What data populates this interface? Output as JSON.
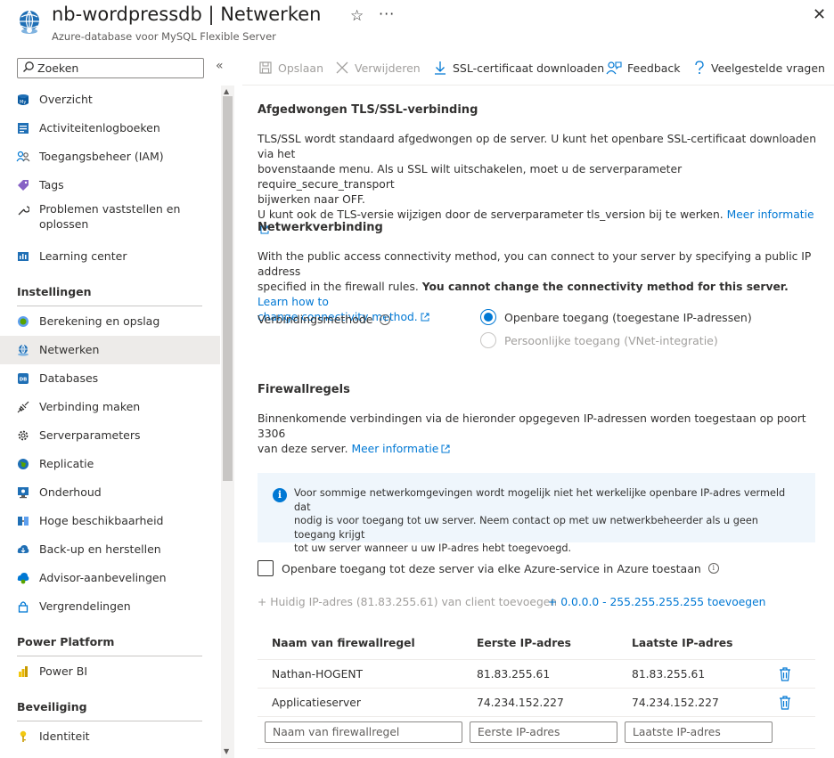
{
  "header": {
    "title": "nb-wordpressdb | Netwerken",
    "subtitle": "Azure-database voor MySQL Flexible Server",
    "favorite_glyph": "☆",
    "more_glyph": "···",
    "close_glyph": "✕"
  },
  "sidebar": {
    "search_placeholder": "Zoeken",
    "collapse_glyph": "«",
    "items": [
      {
        "label": "Overzicht",
        "icon": "mysql-icon"
      },
      {
        "label": "Activiteitenlogboeken",
        "icon": "log-icon"
      },
      {
        "label": "Toegangsbeheer (IAM)",
        "icon": "people-icon"
      },
      {
        "label": "Tags",
        "icon": "tag-icon"
      },
      {
        "label": "Problemen vaststellen en",
        "label2": "oplossen",
        "icon": "wrench-icon"
      },
      {
        "label": "Learning center",
        "icon": "learning-icon"
      }
    ],
    "section_settings": "Instellingen",
    "settings_items": [
      {
        "label": "Berekening en opslag",
        "icon": "compute-icon"
      },
      {
        "label": "Netwerken",
        "icon": "network-icon",
        "active": true
      },
      {
        "label": "Databases",
        "icon": "database-icon"
      },
      {
        "label": "Verbinding maken",
        "icon": "plug-icon"
      },
      {
        "label": "Serverparameters",
        "icon": "gear-icon"
      },
      {
        "label": "Replicatie",
        "icon": "globe-icon"
      },
      {
        "label": "Onderhoud",
        "icon": "monitor-icon"
      },
      {
        "label": "Hoge beschikbaarheid",
        "icon": "ha-icon"
      },
      {
        "label": "Back-up en herstellen",
        "icon": "backup-icon"
      },
      {
        "label": "Advisor-aanbevelingen",
        "icon": "advisor-icon"
      },
      {
        "label": "Vergrendelingen",
        "icon": "lock-icon"
      }
    ],
    "section_power": "Power Platform",
    "power_items": [
      {
        "label": "Power BI",
        "icon": "powerbi-icon"
      }
    ],
    "section_security": "Beveiliging",
    "security_items": [
      {
        "label": "Identiteit",
        "icon": "key-icon"
      }
    ]
  },
  "toolbar": {
    "save": "Opslaan",
    "delete": "Verwijderen",
    "download_ssl": "SSL-certificaat downloaden",
    "feedback": "Feedback",
    "faq": "Veelgestelde vragen"
  },
  "tls": {
    "heading": "Afgedwongen TLS/SSL-verbinding",
    "line1": "TLS/SSL wordt standaard afgedwongen op de server. U kunt het openbare SSL-certificaat downloaden via het",
    "line2": "bovenstaande menu. Als u SSL wilt uitschakelen, moet u de serverparameter require_secure_transport",
    "line3": "bijwerken naar OFF.",
    "line4": "U kunt ook de TLS-versie wijzigen door de serverparameter tls_version bij te werken.",
    "link": "Meer informatie"
  },
  "network": {
    "heading": "Netwerkverbinding",
    "line1": "With the public access connectivity method, you can connect to your server by specifying a public IP address",
    "line2a": "specified in the firewall rules.",
    "line2b": "You cannot change the connectivity method for this server.",
    "link1": "Learn how to",
    "link2": "change connectivity method.",
    "method_label": "Verbindingsmethode",
    "option_public": "Openbare toegang (toegestane IP-adressen)",
    "option_private": "Persoonlijke toegang (VNet-integratie)"
  },
  "firewall": {
    "heading": "Firewallregels",
    "line1": "Binnenkomende verbindingen via de hieronder opgegeven IP-adressen worden toegestaan op poort 3306",
    "line2": "van deze server.",
    "link": "Meer informatie",
    "info_line1": "Voor sommige netwerkomgevingen wordt mogelijk niet het werkelijke openbare IP-adres vermeld dat",
    "info_line2": "nodig is voor toegang tot uw server. Neem contact op met uw netwerkbeheerder als u geen toegang krijgt",
    "info_line3": "tot uw server wanneer u uw IP-adres hebt toegevoegd.",
    "allow_azure": "Openbare toegang tot deze server via elke Azure-service in Azure toestaan",
    "add_client": "+ Huidig IP-adres (81.83.255.61) van client toevoegen",
    "add_all": "+ 0.0.0.0 - 255.255.255.255 toevoegen",
    "columns": [
      "Naam van firewallregel",
      "Eerste IP-adres",
      "Laatste IP-adres"
    ],
    "rows": [
      {
        "name": "Nathan-HOGENT",
        "start": "81.83.255.61",
        "end": "81.83.255.61"
      },
      {
        "name": "Applicatieserver",
        "start": "74.234.152.227",
        "end": "74.234.152.227"
      }
    ],
    "ph_name": "Naam van firewallregel",
    "ph_start": "Eerste IP-adres",
    "ph_end": "Laatste IP-adres"
  },
  "colors": {
    "accent": "#0078d4",
    "text": "#323130",
    "disabled": "#a19f9d"
  }
}
